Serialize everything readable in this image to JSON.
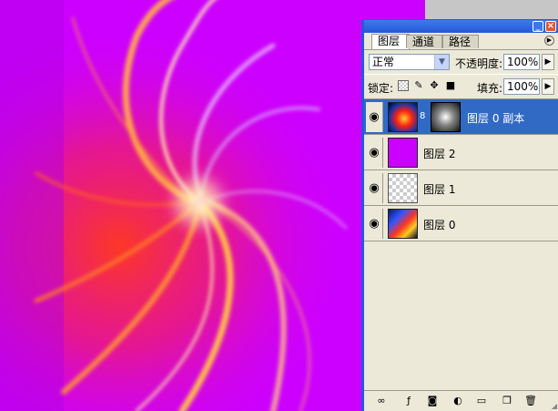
{
  "panel": {
    "tabs": [
      {
        "label": "图层"
      },
      {
        "label": "通道"
      },
      {
        "label": "路径"
      }
    ],
    "blend_mode": "正常",
    "opacity_label": "不透明度:",
    "opacity_value": "100%",
    "lock_label": "锁定:",
    "fill_label": "填充:",
    "fill_value": "100%"
  },
  "layers": [
    {
      "name": "图层 0 副本",
      "selected": true,
      "has_mask": true
    },
    {
      "name": "图层 2",
      "selected": false,
      "has_mask": false
    },
    {
      "name": "图层 1",
      "selected": false,
      "has_mask": false
    },
    {
      "name": "图层 0",
      "selected": false,
      "has_mask": false
    }
  ],
  "colors": {
    "canvas_background": "#cc00ff",
    "selection": "#316ac5",
    "titlebar": "#2458d8"
  },
  "icons": {
    "link": "link-icon",
    "effects": "layer-style-icon",
    "mask": "add-mask-icon",
    "adjustment": "adjustment-layer-icon",
    "group": "folder-icon",
    "new_layer": "new-layer-icon",
    "delete": "trash-icon"
  }
}
